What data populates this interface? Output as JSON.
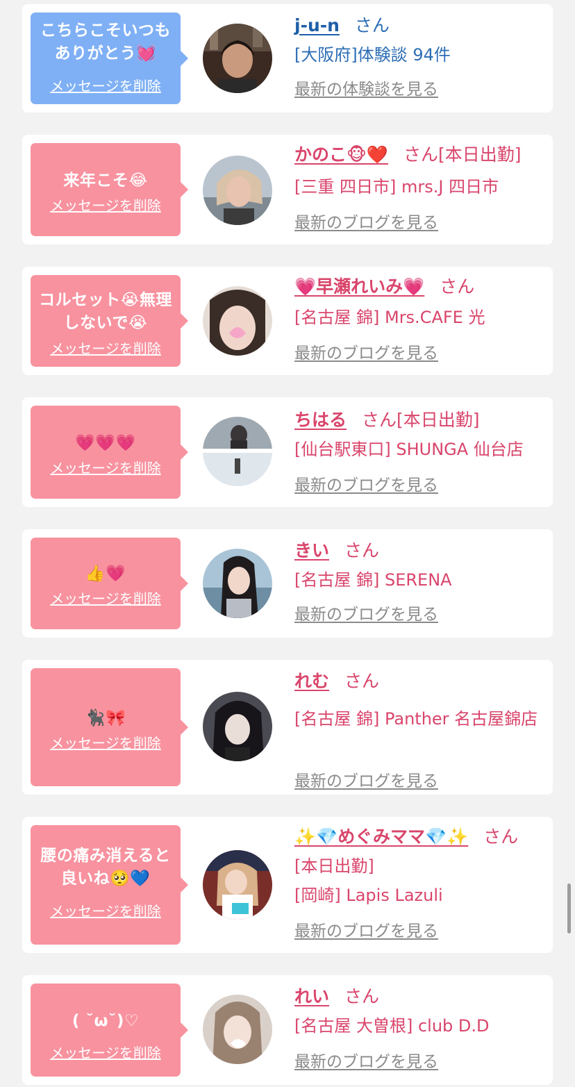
{
  "messages": [
    {
      "bubble_text": "こちらこそいつもありがとう💓",
      "delete_label": "メッセージを削除",
      "name": "j-u-n",
      "suffix": "さん",
      "shop": "[大阪府]体験談 94件",
      "latest_link": "最新の体験談を見る"
    },
    {
      "bubble_text": "来年こそ😂",
      "delete_label": "メッセージを削除",
      "name": "かのこ🐵❤️",
      "suffix": "さん[本日出勤]",
      "shop": "[三重 四日市] mrs.J 四日市",
      "latest_link": "最新のブログを見る"
    },
    {
      "bubble_text": "コルセット😭無理しないで😭",
      "delete_label": "メッセージを削除",
      "name": "💗早瀬れいみ💗",
      "suffix": "さん",
      "shop": "[名古屋 錦] Mrs.CAFE 光",
      "latest_link": "最新のブログを見る"
    },
    {
      "bubble_text": "💗💗💗",
      "delete_label": "メッセージを削除",
      "name": "ちはる",
      "suffix": "さん[本日出勤]",
      "shop": "[仙台駅東口] SHUNGA 仙台店",
      "latest_link": "最新のブログを見る"
    },
    {
      "bubble_text": "👍💗",
      "delete_label": "メッセージを削除",
      "name": "きい",
      "suffix": "さん",
      "shop": "[名古屋 錦] SERENA",
      "latest_link": "最新のブログを見る"
    },
    {
      "bubble_text": "🐈‍⬛🎀",
      "delete_label": "メッセージを削除",
      "name": "れむ",
      "suffix": "さん",
      "shop": "[名古屋 錦] Panther 名古屋錦店",
      "latest_link": "最新のブログを見る"
    },
    {
      "bubble_text": "腰の痛み消えると良いね🥺💙",
      "delete_label": "メッセージを削除",
      "name": "✨💎めぐみママ💎✨",
      "suffix": "さん",
      "status": "[本日出勤]",
      "shop": "[岡崎] Lapis Lazuli",
      "latest_link": "最新のブログを見る"
    },
    {
      "bubble_text": "( ˘ω˘)♡",
      "delete_label": "メッセージを削除",
      "name": "れい",
      "suffix": "さん",
      "shop": "[名古屋 大曽根] club D.D",
      "latest_link": "最新のブログを見る"
    }
  ],
  "colors": {
    "blue_accent": "#7fb0f5",
    "pink_accent": "#f8929f",
    "blue_text": "#1f5fa8",
    "pink_text": "#d9456b",
    "link_gray": "#8a8a8a"
  }
}
